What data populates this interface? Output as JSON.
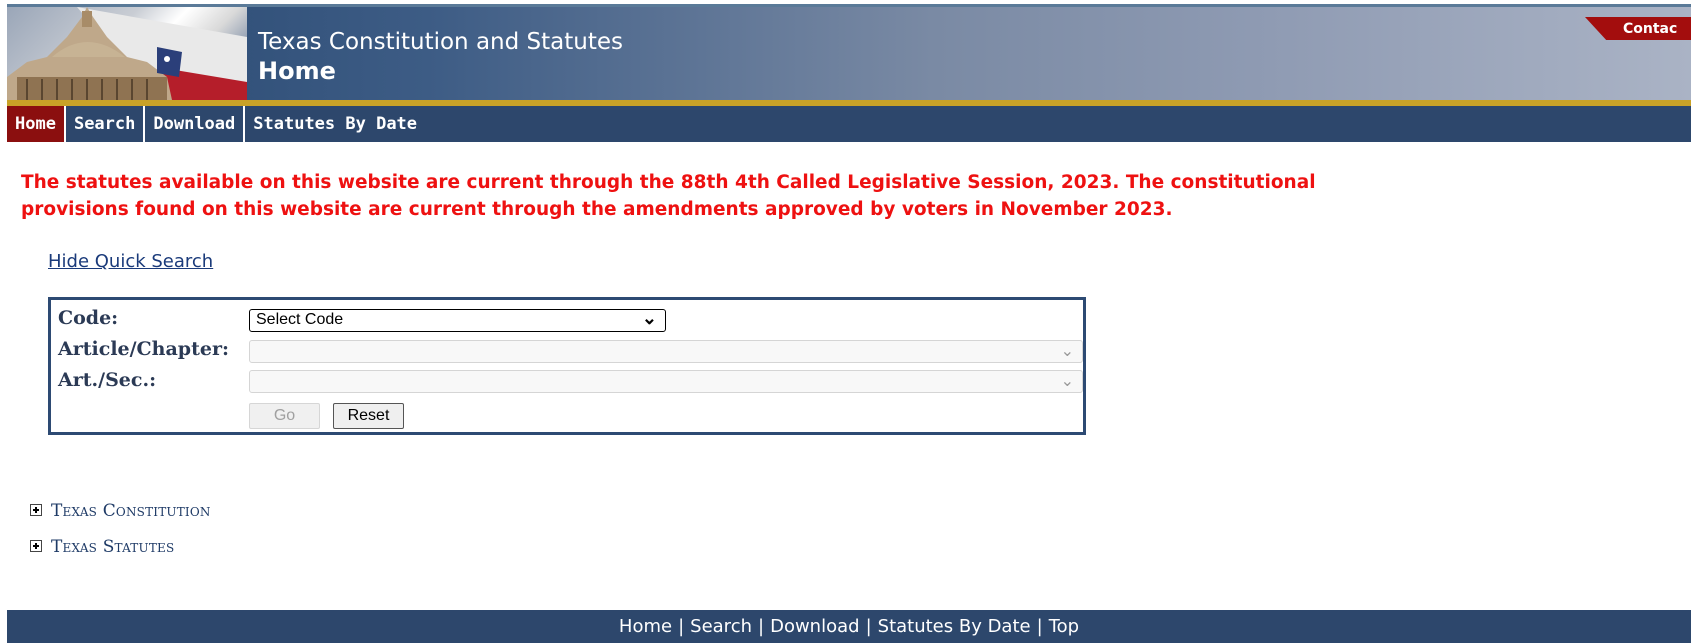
{
  "header": {
    "title": "Texas Constitution and Statutes",
    "subtitle": "Home",
    "contact_label": "Contac"
  },
  "nav": {
    "items": [
      "Home",
      "Search",
      "Download",
      "Statutes By Date"
    ],
    "active": "Home"
  },
  "notice": {
    "text": "The statutes available on this website are current through the 88th 4th Called Legislative Session, 2023. The constitutional provisions found on this website are current through the amendments approved by voters in November 2023."
  },
  "quick_search": {
    "toggle_label": "Hide Quick Search",
    "code_label": "Code:",
    "code_value": "Select Code",
    "article_label": "Article/Chapter:",
    "section_label": "Art./Sec.:",
    "go_label": "Go",
    "reset_label": "Reset"
  },
  "tree": {
    "items": [
      "Texas Constitution",
      "Texas Statutes"
    ]
  },
  "footer": {
    "links": [
      "Home",
      "Search",
      "Download",
      "Statutes By Date",
      "Top"
    ]
  },
  "colors": {
    "notice_red": "#ee1111",
    "nav_blue": "#2d476c",
    "active_red": "#8b0f0f",
    "gold": "#c9a227"
  }
}
